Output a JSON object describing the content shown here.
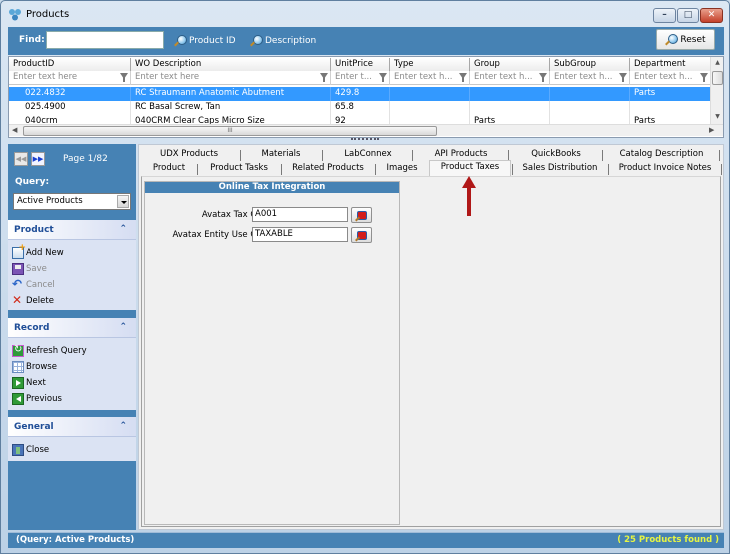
{
  "window": {
    "title": "Products",
    "controls": {
      "minimize": "–",
      "maximize": "□",
      "close": "✕"
    }
  },
  "findbar": {
    "label": "Find:",
    "input_value": "",
    "product_id_button": "Product ID",
    "description_button": "Description",
    "reset_button": "Reset"
  },
  "grid": {
    "columns": [
      {
        "header": "ProductID",
        "filter_placeholder": "Enter text here"
      },
      {
        "header": "WO Description",
        "filter_placeholder": "Enter text here"
      },
      {
        "header": "UnitPrice",
        "filter_placeholder": "Enter t..."
      },
      {
        "header": "Type",
        "filter_placeholder": "Enter text h..."
      },
      {
        "header": "Group",
        "filter_placeholder": "Enter text h..."
      },
      {
        "header": "SubGroup",
        "filter_placeholder": "Enter text h..."
      },
      {
        "header": "Department",
        "filter_placeholder": "Enter text h..."
      }
    ],
    "rows": [
      {
        "cells": [
          "022.4832",
          "RC Straumann Anatomic Abutment",
          "429.8",
          "",
          "",
          "",
          "Parts"
        ],
        "selected": true
      },
      {
        "cells": [
          "025.4900",
          "RC Basal Screw, Tan",
          "65.8",
          "",
          "",
          "",
          ""
        ],
        "selected": false
      },
      {
        "cells": [
          "040crm",
          "040CRM Clear Caps Micro Size",
          "92",
          "",
          "Parts",
          "",
          "Parts"
        ],
        "selected": false
      }
    ],
    "hscroll_grip": "III"
  },
  "sidebar": {
    "pager": {
      "prev_label": "◀◀",
      "next_label": "▶▶",
      "page_text": "Page 1/82"
    },
    "query": {
      "label": "Query:",
      "selected": "Active Products"
    },
    "panels": [
      {
        "title": "Product",
        "items": [
          {
            "label": "Add New",
            "icon": "add-new-icon",
            "enabled": true
          },
          {
            "label": "Save",
            "icon": "save-icon",
            "enabled": false
          },
          {
            "label": "Cancel",
            "icon": "cancel-icon",
            "enabled": false
          },
          {
            "label": "Delete",
            "icon": "delete-icon",
            "enabled": true
          }
        ]
      },
      {
        "title": "Record",
        "items": [
          {
            "label": "Refresh Query",
            "icon": "refresh-icon",
            "enabled": true
          },
          {
            "label": "Browse",
            "icon": "browse-icon",
            "enabled": true
          },
          {
            "label": "Next",
            "icon": "next-icon",
            "enabled": true
          },
          {
            "label": "Previous",
            "icon": "previous-icon",
            "enabled": true
          }
        ]
      },
      {
        "title": "General",
        "items": [
          {
            "label": "Close",
            "icon": "close-door-icon",
            "enabled": true
          }
        ]
      }
    ],
    "collapse_glyph": "⌃"
  },
  "tabs": {
    "row_top": [
      "UDX Products",
      "Materials",
      "LabConnex",
      "API Products",
      "QuickBooks",
      "Catalog Description"
    ],
    "row_bottom": [
      "Product",
      "Product Tasks",
      "Related Products",
      "Images",
      "Product Taxes",
      "Sales Distribution",
      "Product Invoice Notes"
    ],
    "active": "Product Taxes"
  },
  "tax_panel": {
    "title": "Online Tax Integration",
    "fields": [
      {
        "label": "Avatax Tax Code:",
        "value": "A001"
      },
      {
        "label": "Avatax Entity Use Code:",
        "value": "TAXABLE"
      }
    ]
  },
  "statusbar": {
    "left": "(Query: Active Products)",
    "right": "( 25 Products found )"
  },
  "colors": {
    "accent_blue": "#4682b4",
    "selection": "#3399ff",
    "status_highlight": "#e7f542",
    "annotation_arrow": "#b01818"
  }
}
